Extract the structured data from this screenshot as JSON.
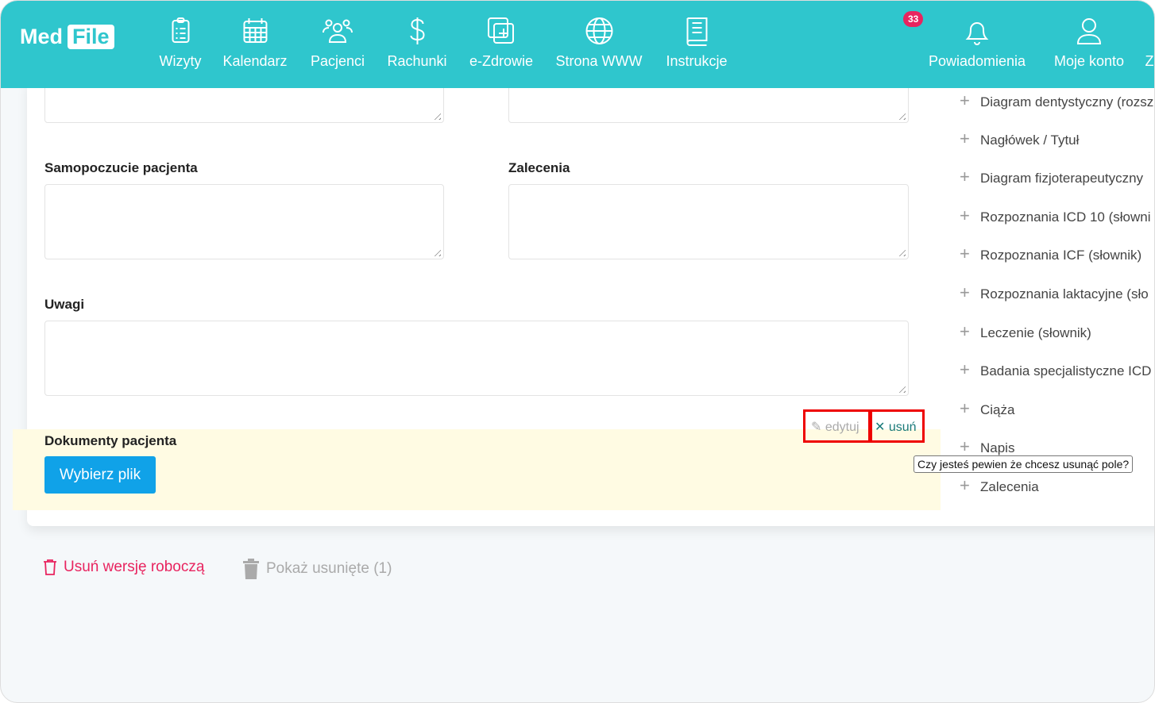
{
  "app": {
    "logo_left": "Med",
    "logo_right": "File"
  },
  "nav": [
    {
      "label": "Wizyty",
      "icon": "clipboard-list-icon"
    },
    {
      "label": "Kalendarz",
      "icon": "calendar-icon"
    },
    {
      "label": "Pacjenci",
      "icon": "users-icon"
    },
    {
      "label": "Rachunki",
      "icon": "dollar-icon"
    },
    {
      "label": "e-Zdrowie",
      "icon": "medical-plus-icon"
    },
    {
      "label": "Strona WWW",
      "icon": "globe-icon"
    },
    {
      "label": "Instrukcje",
      "icon": "book-icon"
    },
    {
      "label": "Powiadomienia",
      "icon": "bell-icon",
      "badge": "33"
    },
    {
      "label": "Moje konto",
      "icon": "user-icon"
    },
    {
      "label": "Z"
    }
  ],
  "form": {
    "wellbeing_label": "Samopoczucie pacjenta",
    "recommendations_label": "Zalecenia",
    "notes_label": "Uwagi",
    "documents_label": "Dokumenty pacjenta",
    "choose_file": "Wybierz plik",
    "edit": "edytuj",
    "delete": "usuń",
    "tooltip": "Czy jesteś pewien że chcesz usunąć pole?"
  },
  "fields": [
    "Diagram dentystyczny (rozsz",
    "Nagłówek / Tytuł",
    "Diagram fizjoterapeutyczny",
    "Rozpoznania ICD 10 (słowni",
    "Rozpoznania ICF (słownik)",
    "Rozpoznania laktacyjne (sło",
    "Leczenie (słownik)",
    "Badania specjalistyczne ICD",
    "Ciąża",
    "Napis",
    "Zalecenia"
  ],
  "footer": {
    "delete_draft": "Usuń wersję roboczą",
    "show_deleted": "Pokaż usunięte (1)"
  },
  "colors": {
    "accent": "#2fc6cd",
    "danger": "#e8245f",
    "button": "#10a2e8"
  }
}
